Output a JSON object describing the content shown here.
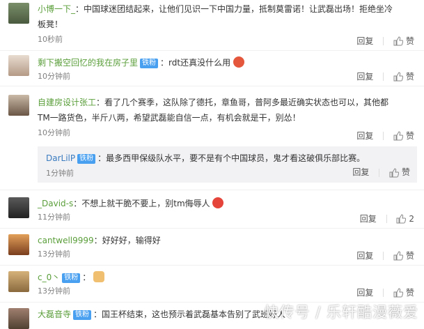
{
  "actions": {
    "reply": "回复",
    "like": "赞"
  },
  "badge_fan": "铁粉",
  "comments": [
    {
      "user": "小博一下_",
      "text": "中国球迷团结起来，让他们见识一下中国力量，抵制莫雷诺！让武磊出场！拒绝坐冷",
      "text2": "板凳！",
      "time": "10秒前"
    },
    {
      "user": "剩下搬空回忆的我在房子里",
      "text": "rdt还真没什么用",
      "time": "10分钟前"
    },
    {
      "user": "自建房设计张工",
      "text": "看了几个赛季，这队除了德托，章鱼哥，普阿多最近确实状态也可以，其他都",
      "text2": "TM一路货色，半斤八两，希望武磊能自信一点，有机会就是干，别怂！",
      "time": "10分钟前"
    },
    {
      "user": "DarLilP",
      "text": "最多西甲保级队水平，要不是有个中国球员，鬼才看这破俱乐部比赛。",
      "time": "1分钟前"
    },
    {
      "user": "_David-s",
      "text": "不想上就干脆不要上，别tm侮辱人",
      "time": "11分钟前",
      "likes": "2"
    },
    {
      "user": "cantwell9999",
      "text": "好好好，输得好",
      "time": "13分钟前"
    },
    {
      "user": "c_0丶",
      "text": "",
      "time": "13分钟前"
    },
    {
      "user": "大磊音寺",
      "text": "国王杯结束，这也预示着武磊基本告别了武班好人"
    }
  ],
  "watermark": "快传号 / 乐轩酷漫薇爱"
}
